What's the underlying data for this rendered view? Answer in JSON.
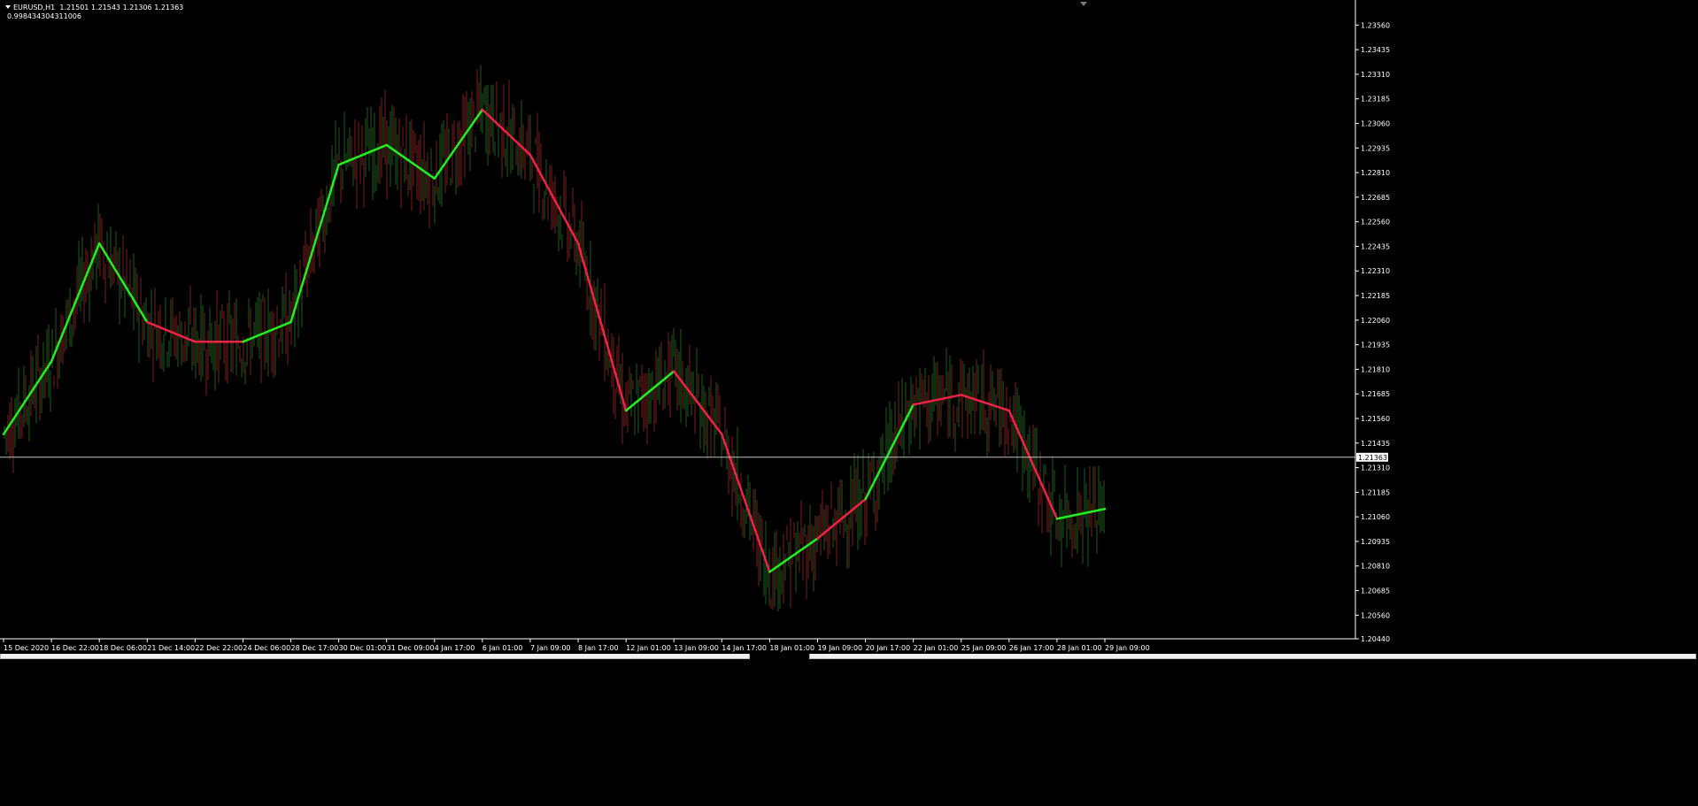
{
  "window": {
    "title": "EURUSD,H1",
    "ohlc": "1.21501 1.21543 1.21306 1.21363",
    "indicator_value": "0.998434304311006"
  },
  "price_axis": {
    "labels": [
      "1.23560",
      "1.23435",
      "1.23310",
      "1.23185",
      "1.23060",
      "1.22935",
      "1.22810",
      "1.22685",
      "1.22560",
      "1.22435",
      "1.22310",
      "1.22185",
      "1.22060",
      "1.21935",
      "1.21810",
      "1.21685",
      "1.21560",
      "1.21435",
      "1.21310",
      "1.21185",
      "1.21060",
      "1.20935",
      "1.20810",
      "1.20685",
      "1.20560",
      "1.20440"
    ],
    "current_price": "1.21363"
  },
  "time_axis": {
    "labels": [
      "15 Dec 2020",
      "16 Dec 22:00",
      "18 Dec 06:00",
      "21 Dec 14:00",
      "22 Dec 22:00",
      "24 Dec 06:00",
      "28 Dec 17:00",
      "30 Dec 01:00",
      "31 Dec 09:00",
      "4 Jan 17:00",
      "6 Jan 01:00",
      "7 Jan 09:00",
      "8 Jan 17:00",
      "12 Jan 01:00",
      "13 Jan 09:00",
      "14 Jan 17:00",
      "18 Jan 01:00",
      "19 Jan 09:00",
      "20 Jan 17:00",
      "22 Jan 01:00",
      "25 Jan 09:00",
      "26 Jan 17:00",
      "28 Jan 01:00",
      "29 Jan 09:00"
    ]
  },
  "colors": {
    "background": "#000000",
    "axis": "#ffffff",
    "bull_candle": "#1f5a1f",
    "bear_candle": "#7a1f1f",
    "trend_up": "#22ee22",
    "trend_down": "#ee2244",
    "price_line": "#c0c0c0"
  },
  "chart_data": {
    "type": "line",
    "symbol": "EURUSD",
    "timeframe": "H1",
    "ylim": [
      1.2044,
      1.2362
    ],
    "series": [
      {
        "color": "trend",
        "x": [
          "15 Dec 2020",
          "16 Dec 22:00",
          "18 Dec 06:00",
          "21 Dec 14:00",
          "22 Dec 22:00",
          "24 Dec 06:00",
          "28 Dec 17:00",
          "30 Dec 01:00",
          "31 Dec 09:00",
          "4 Jan 17:00",
          "6 Jan 01:00",
          "7 Jan 09:00",
          "8 Jan 17:00",
          "12 Jan 01:00",
          "13 Jan 09:00",
          "14 Jan 17:00",
          "18 Jan 01:00",
          "19 Jan 09:00",
          "20 Jan 17:00",
          "22 Jan 01:00",
          "25 Jan 09:00",
          "26 Jan 17:00",
          "28 Jan 01:00",
          "29 Jan 09:00"
        ],
        "values": [
          1.2148,
          1.2185,
          1.2245,
          1.2205,
          1.2195,
          1.2195,
          1.2205,
          1.2285,
          1.2295,
          1.2278,
          1.2313,
          1.229,
          1.2245,
          1.216,
          1.218,
          1.2148,
          1.2078,
          1.2095,
          1.2115,
          1.2163,
          1.2168,
          1.216,
          1.2105,
          1.211
        ],
        "trend": [
          "up",
          "up",
          "up",
          "up",
          "down",
          "down",
          "up",
          "up",
          "up",
          "up",
          "up",
          "down",
          "down",
          "down",
          "up",
          "down",
          "down",
          "up",
          "down",
          "up",
          "down",
          "down",
          "down",
          "up"
        ]
      }
    ]
  }
}
